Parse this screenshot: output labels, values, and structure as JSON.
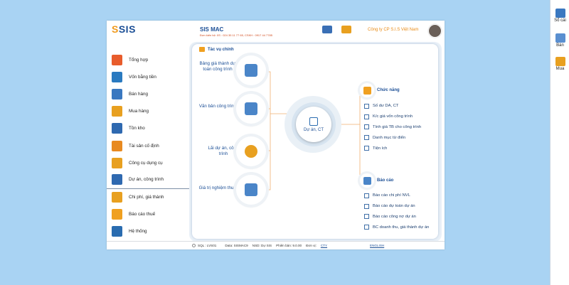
{
  "right_bar": {
    "items": [
      {
        "label": "Sổ cái",
        "icon": "ledger-icon"
      },
      {
        "label": "Bán",
        "icon": "sale-icon"
      },
      {
        "label": "Mua",
        "icon": "purchase-icon"
      }
    ]
  },
  "header": {
    "logo_s": "S",
    "logo_rest": "SIS",
    "app_title": "SIS MAC",
    "app_sub": "Đơn kiến hệ: 0S : 024 35 11 77 65, CSKH : 0917 44 7785",
    "company": "Công ty CP S.I.S Việt Nam"
  },
  "sidebar": {
    "items": [
      {
        "label": "Tổng hợp",
        "color": "#e85c2c"
      },
      {
        "label": "Vốn bằng tiền",
        "color": "#2a7ac0"
      },
      {
        "label": "Bán hàng",
        "color": "#3a78c0"
      },
      {
        "label": "Mua hàng",
        "color": "#e8a020"
      },
      {
        "label": "Tồn kho",
        "color": "#2f69b0"
      },
      {
        "label": "Tài sản cố định",
        "color": "#e88a20"
      },
      {
        "label": "Công cụ dụng cụ",
        "color": "#e8a020"
      },
      {
        "label": "Dự án, công trình",
        "color": "#2f69b0"
      },
      {
        "label": "Chi phí, giá thành",
        "color": "#e8a020"
      },
      {
        "label": "Báo cáo thuế",
        "color": "#f0a020"
      },
      {
        "label": "Hệ thống",
        "color": "#2a6cb0"
      }
    ],
    "active_index": 7
  },
  "main": {
    "task_header": "Tác vụ chính",
    "nodes": [
      {
        "label": "Bảng giá thành dự toán công trình",
        "color": "#4a85c8"
      },
      {
        "label": "Văn bản công trình",
        "color": "#4a85c8"
      },
      {
        "label": "Lãi dự án, công trình",
        "color": "#e8a020"
      },
      {
        "label": "Giá trị nghiệm thu",
        "color": "#4a85c8"
      }
    ],
    "center_label": "Dự án, CT",
    "functions": {
      "title": "Chức năng",
      "items": [
        "Số dư DA, CT",
        "K/c giá vốn công trình",
        "Tính giá TB cho công trình",
        "Danh mục từ điển",
        "Tiện ích"
      ]
    },
    "reports": {
      "title": "Báo cáo",
      "items": [
        "Báo cáo chi phí NVL",
        "Báo cáo dự toán dự án",
        "Báo cáo công nợ dự án",
        "BC doanh thu, giá thành dự án"
      ]
    }
  },
  "status": {
    "sql": "SQL : LVS01",
    "data": "Data: SISMAC9",
    "nsd": "NSD: Dự SIS",
    "version": "Phiên bản: 9.0.00",
    "unit_label": "Đơn vị:",
    "unit_value": "CTY",
    "language": "ENGLISH"
  },
  "colors": {
    "accent": "#1c4f96",
    "orange": "#e98b16",
    "background": "#a9d3f3"
  }
}
